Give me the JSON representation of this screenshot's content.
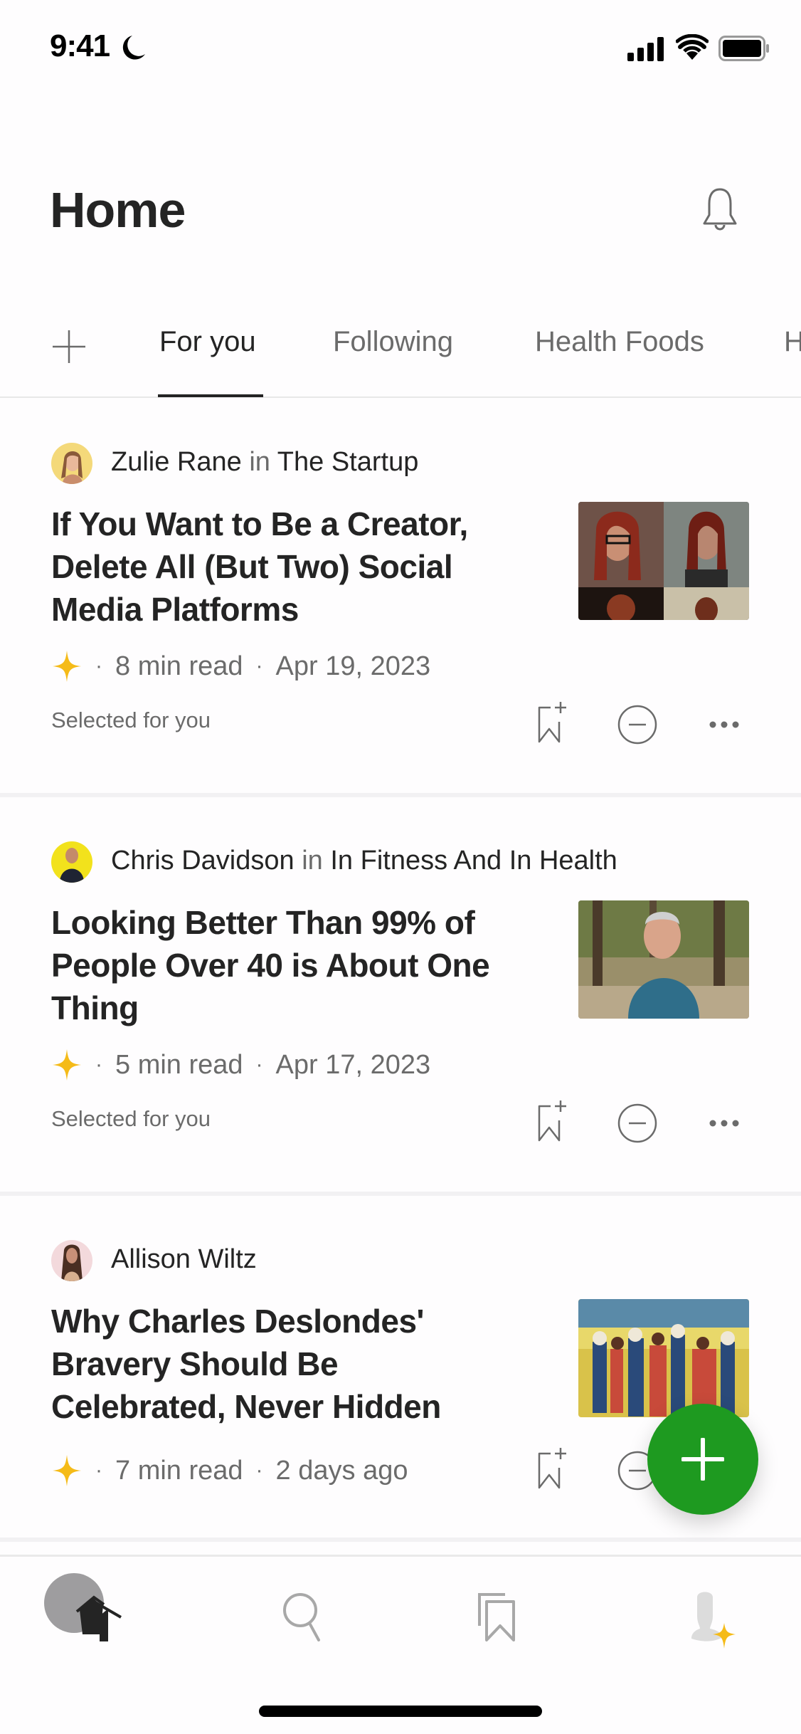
{
  "status_bar": {
    "time": "9:41",
    "icons": [
      "moon-icon",
      "cellular-signal-icon",
      "wifi-icon",
      "battery-icon"
    ]
  },
  "header": {
    "title": "Home",
    "notification_icon": "bell-icon"
  },
  "tabs": {
    "add_icon": "plus-icon",
    "items": [
      {
        "label": "For you",
        "active": true
      },
      {
        "label": "Following",
        "active": false
      },
      {
        "label": "Health Foods",
        "active": false
      },
      {
        "label": "H",
        "active": false
      }
    ]
  },
  "articles": [
    {
      "author": "Zulie Rane",
      "in_label": "in",
      "publication": "The Startup",
      "title": "If You Want to Be a Creator, Delete All (But Two) Social Media Platforms",
      "read_time": "8  min read",
      "date": "Apr 19, 2023",
      "badge": "Selected for you",
      "member_only": true
    },
    {
      "author": "Chris Davidson",
      "in_label": "in",
      "publication": "In Fitness And In Health",
      "title": "Looking Better Than 99% of People Over 40 is About One Thing",
      "read_time": "5  min read",
      "date": "Apr 17, 2023",
      "badge": "Selected for you",
      "member_only": true
    },
    {
      "author": "Allison Wiltz",
      "in_label": "",
      "publication": "",
      "title": "Why Charles Deslondes' Bravery Should Be Celebrated, Never Hidden",
      "read_time": "7  min read",
      "date": "2 days ago",
      "badge": "",
      "member_only": true
    }
  ],
  "meta_separator": "·",
  "fab": {
    "icon": "plus-icon"
  },
  "bottom_nav": {
    "items": [
      {
        "name": "home",
        "icon": "home-icon",
        "active": true
      },
      {
        "name": "search",
        "icon": "search-icon",
        "active": false
      },
      {
        "name": "library",
        "icon": "bookmarks-icon",
        "active": false
      },
      {
        "name": "profile",
        "icon": "profile-icon",
        "active": false
      }
    ]
  },
  "colors": {
    "accent_green": "#1e9a20",
    "star_yellow": "#f5bb18",
    "text_primary": "#242424",
    "text_secondary": "#6b6b6b"
  }
}
